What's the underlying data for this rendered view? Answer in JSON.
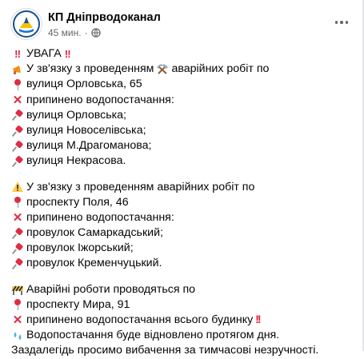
{
  "post": {
    "page_name": "КП Дніпрводоканал",
    "time": "45 мин.",
    "visibility_icon": "globe-icon",
    "more_icon": "more-horizontal-icon",
    "lines": {
      "title": "УВАГА",
      "p1_l1_a": "У зв'язку з проведенням",
      "p1_l1_b": "аварійних робіт по",
      "p1_l2": "вулиця Орловська, 65",
      "p1_l3": "припинено водопостачання:",
      "p1_l4": "вулиця Орловська;",
      "p1_l5": "вулиця Новоселівська;",
      "p1_l6": "вулиця М.Драгоманова;",
      "p1_l7": "вулиця Некрасова.",
      "p2_l1": "У зв'язку з проведенням аварійних робіт по",
      "p2_l2": "проспекту Поля, 46",
      "p2_l3": "припинено водопостачання:",
      "p2_l4": "провулок Самаркадський;",
      "p2_l5": "провулок Іжорський;",
      "p2_l6": "провулок Кременчуцький.",
      "p3_l1": "Аварійні роботи проводяться по",
      "p3_l2": "проспекту Мира, 91",
      "p3_l3": "припинено водопостачання всього будинку",
      "p3_l4": "Водопостачання буде відновлено протягом дня.",
      "p3_l5": "Заздалегідь просимо вибачення за тимчасові незручності."
    }
  },
  "colors": {
    "text": "#050505",
    "secondary": "#65676b",
    "alert_red": "#e41e3f"
  }
}
